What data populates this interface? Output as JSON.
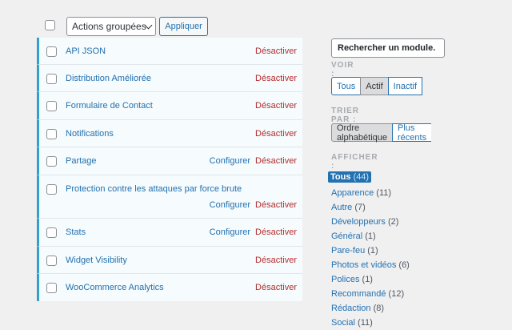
{
  "bulk": {
    "select_label": "Actions groupées",
    "apply_label": "Appliquer"
  },
  "modules": [
    {
      "name": "API JSON",
      "configure": "",
      "deactivate": "Désactiver"
    },
    {
      "name": "Distribution Améliorée",
      "configure": "",
      "deactivate": "Désactiver"
    },
    {
      "name": "Formulaire de Contact",
      "configure": "",
      "deactivate": "Désactiver"
    },
    {
      "name": "Notifications",
      "configure": "",
      "deactivate": "Désactiver"
    },
    {
      "name": "Partage",
      "configure": "Configurer",
      "deactivate": "Désactiver"
    },
    {
      "name": "Protection contre les attaques par force brute",
      "configure": "Configurer",
      "deactivate": "Désactiver"
    },
    {
      "name": "Stats",
      "configure": "Configurer",
      "deactivate": "Désactiver"
    },
    {
      "name": "Widget Visibility",
      "configure": "",
      "deactivate": "Désactiver"
    },
    {
      "name": "WooCommerce Analytics",
      "configure": "",
      "deactivate": "Désactiver"
    }
  ],
  "sidebar": {
    "search_value": "Rechercher un module.",
    "view_heading": "VOIR :",
    "view_buttons": [
      "Tous",
      "Actif",
      "Inactif"
    ],
    "view_active": "Actif",
    "sort_heading": "TRIER PAR :",
    "sort_buttons": [
      "Ordre alphabétique",
      "Plus récents"
    ],
    "sort_active": "Ordre alphabétique",
    "show_heading": "AFFICHER :",
    "categories": [
      {
        "label": "Tous",
        "count": "(44)",
        "current": true
      },
      {
        "label": "Apparence",
        "count": "(11)"
      },
      {
        "label": "Autre",
        "count": "(7)"
      },
      {
        "label": "Développeurs",
        "count": "(2)"
      },
      {
        "label": "Général",
        "count": "(1)"
      },
      {
        "label": "Pare-feu",
        "count": "(1)"
      },
      {
        "label": "Photos et vidéos",
        "count": "(6)"
      },
      {
        "label": "Polices",
        "count": "(1)"
      },
      {
        "label": "Recommandé",
        "count": "(12)"
      },
      {
        "label": "Rédaction",
        "count": "(8)"
      },
      {
        "label": "Social",
        "count": "(11)"
      }
    ]
  },
  "colors": {
    "accent": "#2271b1",
    "danger": "#b32d2e",
    "active_border": "#2ea2cc"
  }
}
